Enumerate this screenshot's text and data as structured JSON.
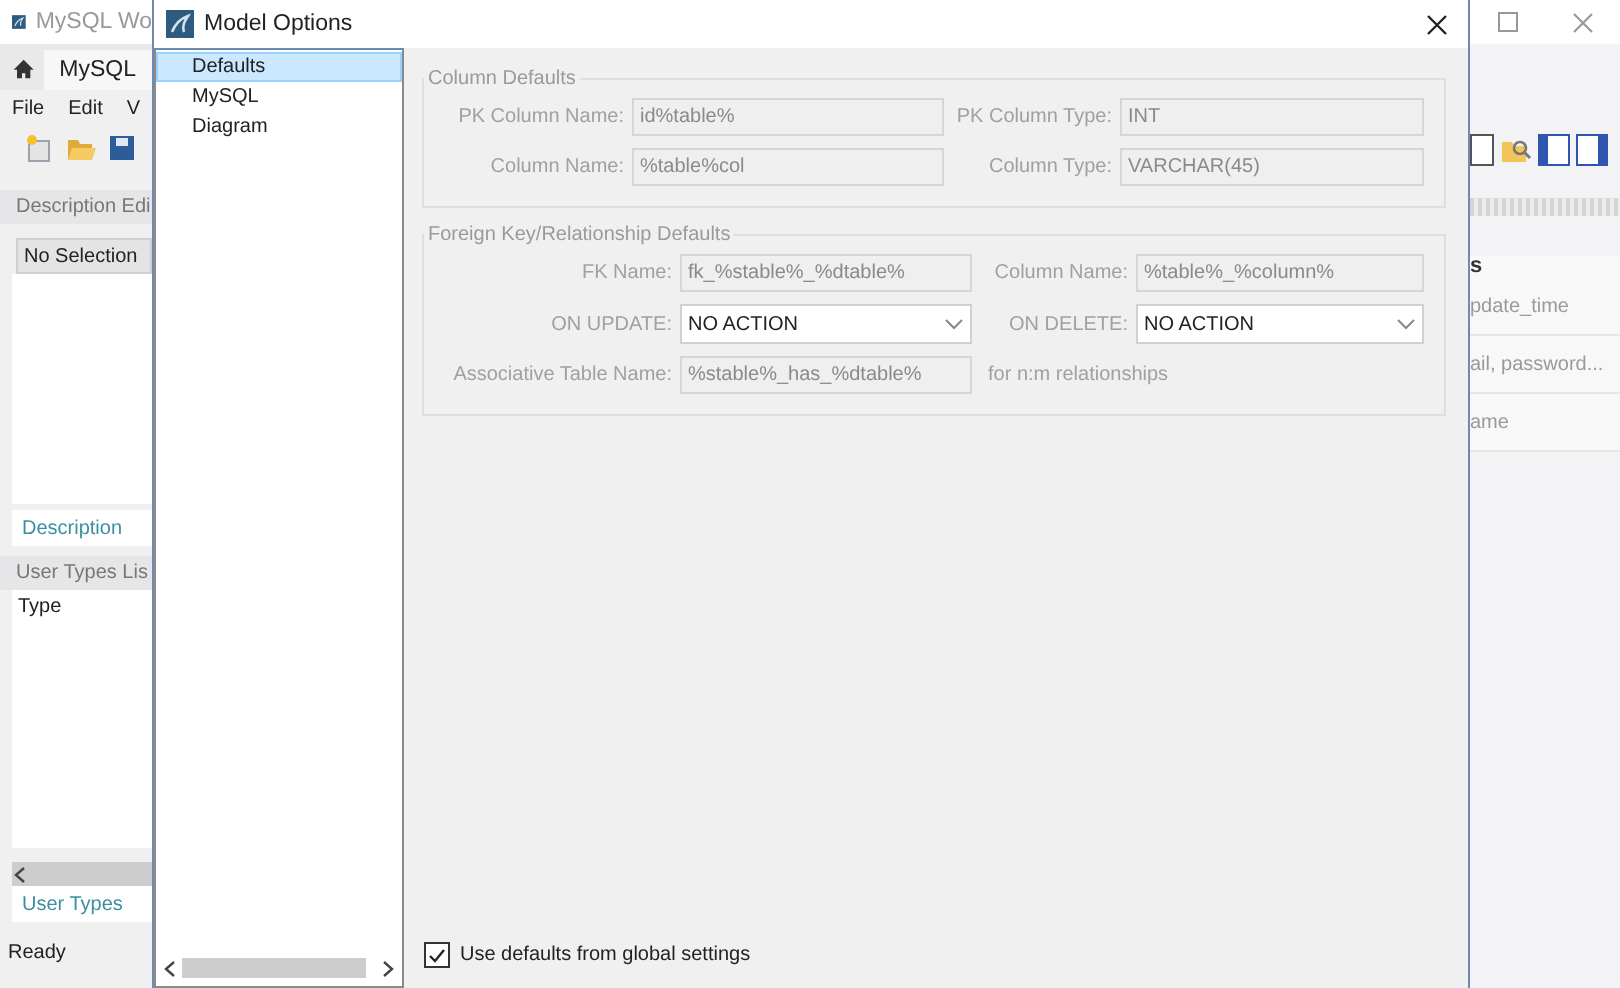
{
  "background_window": {
    "title": "MySQL Wo",
    "tab": "MySQL",
    "menu": [
      "File",
      "Edit",
      "V"
    ],
    "description_panel": {
      "header": "Description Edi",
      "selector": "No Selection",
      "tab": "Description"
    },
    "user_types_panel": {
      "header": "User Types Lis",
      "column": "Type",
      "tab": "User Types"
    },
    "status": "Ready",
    "right_items": [
      {
        "kind": "heading",
        "text": "s"
      },
      {
        "kind": "row",
        "text": "pdate_time"
      },
      {
        "kind": "row",
        "text": "ail, password..."
      },
      {
        "kind": "row",
        "text": "ame"
      }
    ]
  },
  "dialog": {
    "title": "Model Options",
    "nav": [
      {
        "label": "Defaults",
        "selected": true
      },
      {
        "label": "MySQL",
        "selected": false
      },
      {
        "label": "Diagram",
        "selected": false
      }
    ],
    "groups": [
      {
        "title": "Column Defaults",
        "disabled": true,
        "rows": [
          [
            {
              "kind": "text",
              "label": "PK Column Name:",
              "value": "id%table%"
            },
            {
              "kind": "text",
              "label": "PK Column Type:",
              "value": "INT"
            }
          ],
          [
            {
              "kind": "text",
              "label": "Column Name:",
              "value": "%table%col"
            },
            {
              "kind": "text",
              "label": "Column Type:",
              "value": "VARCHAR(45)"
            }
          ]
        ]
      },
      {
        "title": "Foreign Key/Relationship Defaults",
        "disabled": true,
        "rows": [
          [
            {
              "kind": "text",
              "label": "FK Name:",
              "value": "fk_%stable%_%dtable%"
            },
            {
              "kind": "text",
              "label": "Column Name:",
              "value": "%table%_%column%"
            }
          ],
          [
            {
              "kind": "select",
              "label": "ON UPDATE:",
              "value": "NO ACTION"
            },
            {
              "kind": "select",
              "label": "ON DELETE:",
              "value": "NO ACTION"
            }
          ],
          [
            {
              "kind": "text",
              "label": "Associative Table Name:",
              "value": "%stable%_has_%dtable%"
            },
            {
              "kind": "note",
              "text": "for n:m relationships"
            }
          ]
        ]
      }
    ],
    "use_defaults": {
      "label": "Use defaults from global settings",
      "checked": true
    }
  }
}
